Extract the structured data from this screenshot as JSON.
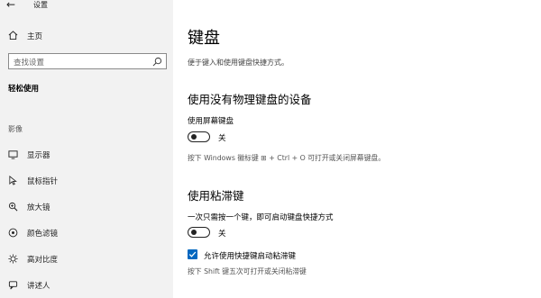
{
  "window": {
    "title": "设置"
  },
  "sidebar": {
    "home_label": "主页",
    "search_placeholder": "查找设置",
    "section_title": "轻松使用",
    "group_title": "影像",
    "items": [
      {
        "label": "显示器",
        "icon": "display-icon"
      },
      {
        "label": "鼠标指针",
        "icon": "mouse-pointer-icon"
      },
      {
        "label": "放大镜",
        "icon": "magnifier-icon"
      },
      {
        "label": "颜色滤镜",
        "icon": "color-filter-icon"
      },
      {
        "label": "高对比度",
        "icon": "contrast-icon"
      },
      {
        "label": "讲述人",
        "icon": "narrator-icon"
      }
    ]
  },
  "main": {
    "title": "键盘",
    "description": "便于键入和使用键盘快捷方式。",
    "onscreen": {
      "heading": "使用没有物理键盘的设备",
      "toggle_label": "使用屏幕键盘",
      "toggle_state": "关",
      "toggle_on": false,
      "hint": "按下 Windows 徽标键 ⊞ + Ctrl + O 可打开或关闭屏幕键盘。"
    },
    "sticky": {
      "heading": "使用粘滞键",
      "toggle_label": "一次只需按一个键，即可启动键盘快捷方式",
      "toggle_state": "关",
      "toggle_on": false,
      "checkbox_label": "允许使用快捷键启动粘滞键",
      "checkbox_checked": true,
      "hint": "按下 Shift 键五次可打开或关闭粘滞键"
    }
  },
  "colors": {
    "accent": "#0067c0",
    "sidebar_bg": "#f2f2f2"
  }
}
